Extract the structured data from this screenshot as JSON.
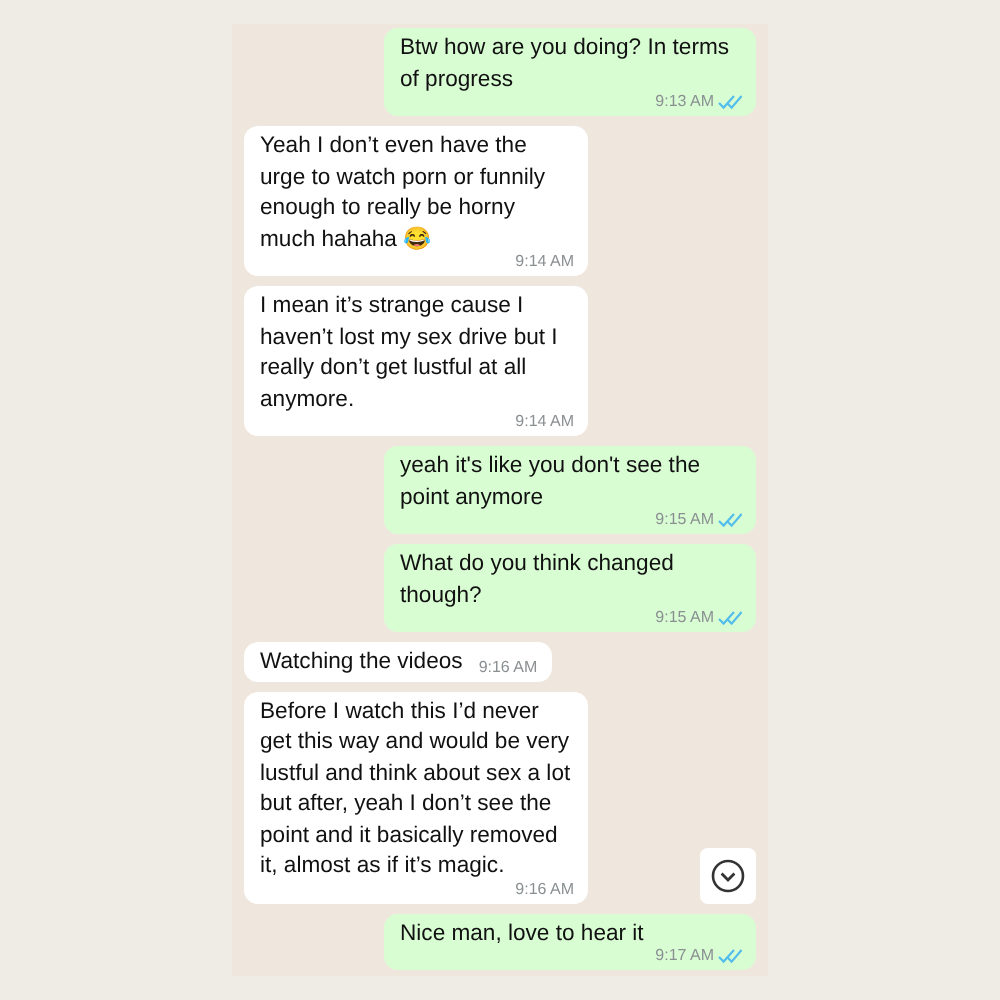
{
  "messages": [
    {
      "kind": "out",
      "text": "Btw how are you doing? In terms of progress",
      "time": "9:13 AM",
      "read": true
    },
    {
      "kind": "in",
      "text": "Yeah I don’t even have the urge to watch porn or funnily enough to really be horny much hahaha 😂",
      "time": "9:14 AM"
    },
    {
      "kind": "in",
      "text": "I mean it’s strange cause I haven’t lost my sex drive but I really don’t get lustful at all anymore.",
      "time": "9:14 AM"
    },
    {
      "kind": "out",
      "text": "yeah it's like you don't see the point anymore",
      "time": "9:15 AM",
      "read": true
    },
    {
      "kind": "out",
      "text": "What do you think changed though?",
      "time": "9:15 AM",
      "read": true
    },
    {
      "kind": "in",
      "text": "Watching the videos",
      "time": "9:16 AM"
    },
    {
      "kind": "in",
      "text": "Before I watch this I’d never get this way and would be very lustful and think about sex a lot but after, yeah I don’t see the point and it basically removed it, almost as if it’s magic.",
      "time": "9:16 AM"
    },
    {
      "kind": "out",
      "text": "Nice man, love to hear it",
      "time": "9:17 AM",
      "read": true
    }
  ]
}
